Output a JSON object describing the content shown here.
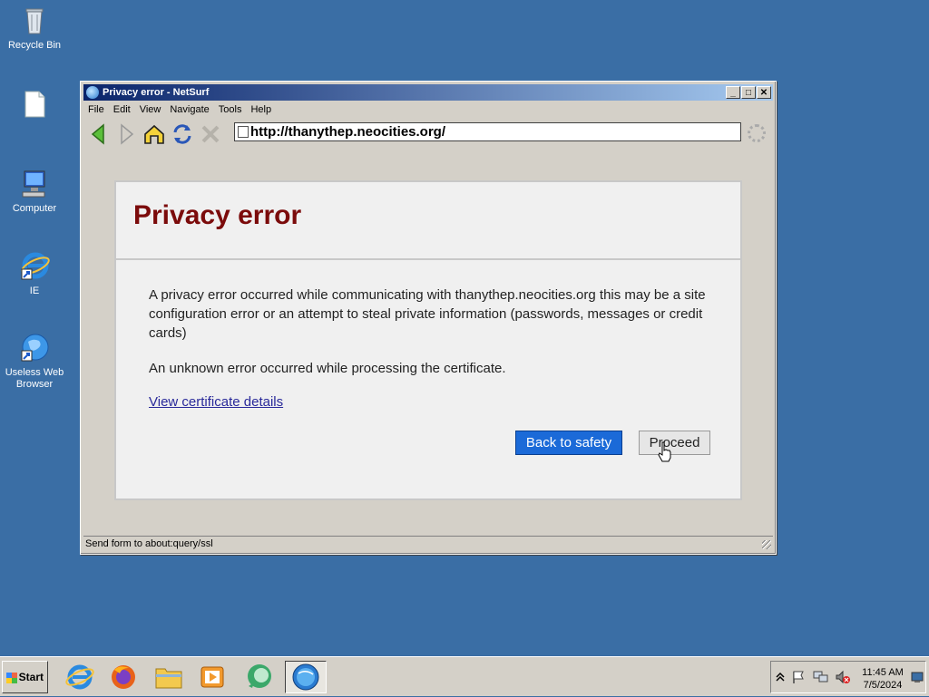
{
  "desktop": {
    "icons": [
      {
        "label": "Recycle Bin",
        "icon": "recycle-bin-icon"
      },
      {
        "label": "",
        "icon": "blank-document-icon"
      },
      {
        "label": "Computer",
        "icon": "computer-icon"
      },
      {
        "label": "IE",
        "icon": "internet-explorer-icon"
      },
      {
        "label": "Useless Web Browser",
        "icon": "globe-shortcut-icon"
      }
    ]
  },
  "window": {
    "title": "Privacy error  - NetSurf",
    "menu": [
      "File",
      "Edit",
      "View",
      "Navigate",
      "Tools",
      "Help"
    ],
    "toolbar": {
      "back": "back-arrow-icon",
      "forward": "forward-arrow-icon",
      "home": "home-icon",
      "reload": "reload-icon",
      "stop": "stop-icon"
    },
    "url": "http://thanythep.neocities.org/",
    "status_text": "Send form to about:query/ssl"
  },
  "page": {
    "heading": "Privacy error",
    "message": "A privacy error occurred while communicating with thanythep.neocities.org this may be a site configuration error or an attempt to steal private information (passwords, messages or credit cards)",
    "detail": "An unknown error occurred while processing the certificate.",
    "cert_link": "View certificate details",
    "back_button": "Back to safety",
    "proceed_button": "Proceed",
    "colors": {
      "heading": "#7b0b0b",
      "primary_button": "#1b6ad8"
    }
  },
  "taskbar": {
    "start_label": "Start",
    "apps": [
      "internet-explorer-icon",
      "firefox-icon",
      "file-explorer-icon",
      "media-player-icon",
      "green-chat-icon",
      "netsurf-icon"
    ],
    "tray_icons": [
      "show-hidden-icon",
      "flag-icon",
      "network-icon",
      "volume-muted-icon"
    ],
    "time": "11:45 AM",
    "date": "7/5/2024"
  }
}
